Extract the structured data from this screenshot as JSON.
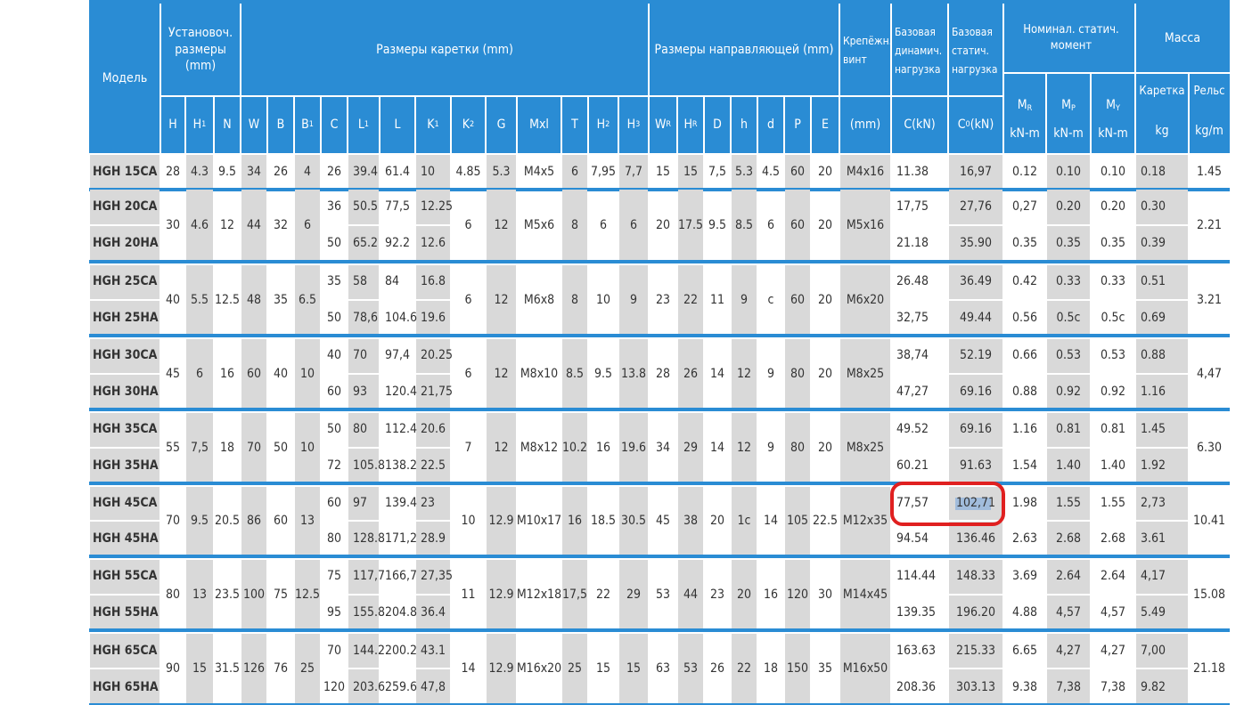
{
  "headers": {
    "model": "Модель",
    "mount": "Установоч. размеры (mm)",
    "carriage": "Размеры каретки (mm)",
    "rail": "Размеры направляющей (mm)",
    "bolt": "Крепёжн. винт",
    "dyn": "Базовая динамич. нагрузка",
    "stat": "Базовая статич. нагрузка",
    "moment": "Номинал. статич. момент",
    "mass": "Масса",
    "carriage_mass": "Каретка",
    "rail_mass": "Рельс"
  },
  "columns": [
    "H",
    "H1",
    "N",
    "W",
    "B",
    "B1",
    "C",
    "L1",
    "L",
    "K1",
    "K2",
    "G",
    "Mxl",
    "T",
    "H2",
    "H3",
    "WR",
    "HR",
    "D",
    "h",
    "d",
    "P",
    "E",
    "(mm)",
    "C(kN)",
    "C0 (kN)",
    "MR",
    "MP",
    "MY"
  ],
  "units": {
    "mr": "kN-m",
    "mp": "kN-m",
    "my": "kN-m",
    "carriage": "kg",
    "rail": "kg/m"
  },
  "groups": [
    {
      "rows": [
        "HGH 15CA"
      ],
      "H": "28",
      "H1": "4.3",
      "N": "9.5",
      "W": "34",
      "B": "26",
      "B1": "4",
      "K2": "4.85",
      "G": "5.3",
      "Mxl": "M4x5",
      "T": "6",
      "H2": "7,95",
      "H3": "7,7",
      "WR": "15",
      "HR": "15",
      "D": "7,5",
      "h": "5.3",
      "d": "4.5",
      "P": "60",
      "E": "20",
      "bolt": "M4x16",
      "rail": "1.45",
      "var": [
        {
          "C": "26",
          "L1": "39.4",
          "L": "61.4",
          "K1": "10",
          "C_dyn": "11.38",
          "C0": "16,97",
          "MR": "0.12",
          "MP": "0.10",
          "MY": "0.10",
          "m": "0.18"
        }
      ]
    },
    {
      "rows": [
        "HGH 20CA",
        "HGH 20HA"
      ],
      "H": "30",
      "H1": "4.6",
      "N": "12",
      "W": "44",
      "B": "32",
      "B1": "6",
      "K2": "6",
      "G": "12",
      "Mxl": "M5x6",
      "T": "8",
      "H2": "6",
      "H3": "6",
      "WR": "20",
      "HR": "17.5",
      "D": "9.5",
      "h": "8.5",
      "d": "6",
      "P": "60",
      "E": "20",
      "bolt": "M5x16",
      "rail": "2.21",
      "var": [
        {
          "C": "36",
          "L1": "50.5",
          "L": "77,5",
          "K1": "12.25",
          "C_dyn": "17,75",
          "C0": "27,76",
          "MR": "0,27",
          "MP": "0.20",
          "MY": "0.20",
          "m": "0.30"
        },
        {
          "C": "50",
          "L1": "65.2",
          "L": "92.2",
          "K1": "12.6",
          "C_dyn": "21.18",
          "C0": "35.90",
          "MR": "0.35",
          "MP": "0.35",
          "MY": "0.35",
          "m": "0.39"
        }
      ]
    },
    {
      "rows": [
        "HGH 25CA",
        "HGH 25HA"
      ],
      "H": "40",
      "H1": "5.5",
      "N": "12.5",
      "W": "48",
      "B": "35",
      "B1": "6.5",
      "K2": "6",
      "G": "12",
      "Mxl": "M6x8",
      "T": "8",
      "H2": "10",
      "H3": "9",
      "WR": "23",
      "HR": "22",
      "D": "11",
      "h": "9",
      "d": "c",
      "P": "60",
      "E": "20",
      "bolt": "M6x20",
      "rail": "3.21",
      "var": [
        {
          "C": "35",
          "L1": "58",
          "L": "84",
          "K1": "16.8",
          "C_dyn": "26.48",
          "C0": "36.49",
          "MR": "0.42",
          "MP": "0.33",
          "MY": "0.33",
          "m": "0.51"
        },
        {
          "C": "50",
          "L1": "78,6",
          "L": "104.6",
          "K1": "19.6",
          "C_dyn": "32,75",
          "C0": "49.44",
          "MR": "0.56",
          "MP": "0.5c",
          "MY": "0.5c",
          "m": "0.69"
        }
      ]
    },
    {
      "rows": [
        "HGH 30CA",
        "HGH 30HA"
      ],
      "H": "45",
      "H1": "6",
      "N": "16",
      "W": "60",
      "B": "40",
      "B1": "10",
      "K2": "6",
      "G": "12",
      "Mxl": "M8x10",
      "T": "8.5",
      "H2": "9.5",
      "H3": "13.8",
      "WR": "28",
      "HR": "26",
      "D": "14",
      "h": "12",
      "d": "9",
      "P": "80",
      "E": "20",
      "bolt": "M8x25",
      "rail": "4,47",
      "var": [
        {
          "C": "40",
          "L1": "70",
          "L": "97,4",
          "K1": "20.25",
          "C_dyn": "38,74",
          "C0": "52.19",
          "MR": "0.66",
          "MP": "0.53",
          "MY": "0.53",
          "m": "0.88"
        },
        {
          "C": "60",
          "L1": "93",
          "L": "120.4",
          "K1": "21,75",
          "C_dyn": "47,27",
          "C0": "69.16",
          "MR": "0.88",
          "MP": "0.92",
          "MY": "0.92",
          "m": "1.16"
        }
      ]
    },
    {
      "rows": [
        "HGH 35CA",
        "HGH 35HA"
      ],
      "H": "55",
      "H1": "7,5",
      "N": "18",
      "W": "70",
      "B": "50",
      "B1": "10",
      "K2": "7",
      "G": "12",
      "Mxl": "M8x12",
      "T": "10.2",
      "H2": "16",
      "H3": "19.6",
      "WR": "34",
      "HR": "29",
      "D": "14",
      "h": "12",
      "d": "9",
      "P": "80",
      "E": "20",
      "bolt": "M8x25",
      "rail": "6.30",
      "var": [
        {
          "C": "50",
          "L1": "80",
          "L": "112.4",
          "K1": "20.6",
          "C_dyn": "49.52",
          "C0": "69.16",
          "MR": "1.16",
          "MP": "0.81",
          "MY": "0.81",
          "m": "1.45"
        },
        {
          "C": "72",
          "L1": "105.8",
          "L": "138.2",
          "K1": "22.5",
          "C_dyn": "60.21",
          "C0": "91.63",
          "MR": "1.54",
          "MP": "1.40",
          "MY": "1.40",
          "m": "1.92"
        }
      ]
    },
    {
      "rows": [
        "HGH 45CA",
        "HGH 45HA"
      ],
      "H": "70",
      "H1": "9.5",
      "N": "20.5",
      "W": "86",
      "B": "60",
      "B1": "13",
      "K2": "10",
      "G": "12.9",
      "Mxl": "M10x17",
      "T": "16",
      "H2": "18.5",
      "H3": "30.5",
      "WR": "45",
      "HR": "38",
      "D": "20",
      "h": "1c",
      "d": "14",
      "P": "105",
      "E": "22.5",
      "bolt": "M12x35",
      "rail": "10.41",
      "var": [
        {
          "C": "60",
          "L1": "97",
          "L": "139.4",
          "K1": "23",
          "C_dyn": "77,57",
          "C0": "102,71",
          "MR": "1.98",
          "MP": "1.55",
          "MY": "1.55",
          "m": "2,73"
        },
        {
          "C": "80",
          "L1": "128.8",
          "L": "171,2",
          "K1": "28.9",
          "C_dyn": "94.54",
          "C0": "136.46",
          "MR": "2.63",
          "MP": "2.68",
          "MY": "2.68",
          "m": "3.61"
        }
      ]
    },
    {
      "rows": [
        "HGH 55CA",
        "HGH 55HA"
      ],
      "H": "80",
      "H1": "13",
      "N": "23.5",
      "W": "100",
      "B": "75",
      "B1": "12.5",
      "K2": "11",
      "G": "12.9",
      "Mxl": "M12x18",
      "T": "17,5",
      "H2": "22",
      "H3": "29",
      "WR": "53",
      "HR": "44",
      "D": "23",
      "h": "20",
      "d": "16",
      "P": "120",
      "E": "30",
      "bolt": "M14x45",
      "rail": "15.08",
      "var": [
        {
          "C": "75",
          "L1": "117,7",
          "L": "166,7",
          "K1": "27,35",
          "C_dyn": "114.44",
          "C0": "148.33",
          "MR": "3.69",
          "MP": "2.64",
          "MY": "2.64",
          "m": "4,17"
        },
        {
          "C": "95",
          "L1": "155.8",
          "L": "204.8",
          "K1": "36.4",
          "C_dyn": "139.35",
          "C0": "196.20",
          "MR": "4.88",
          "MP": "4,57",
          "MY": "4,57",
          "m": "5.49"
        }
      ]
    },
    {
      "rows": [
        "HGH 65CA",
        "HGH 65HA"
      ],
      "H": "90",
      "H1": "15",
      "N": "31.5",
      "W": "126",
      "B": "76",
      "B1": "25",
      "K2": "14",
      "G": "12.9",
      "Mxl": "M16x20",
      "T": "25",
      "H2": "15",
      "H3": "15",
      "WR": "63",
      "HR": "53",
      "D": "26",
      "h": "22",
      "d": "18",
      "P": "150",
      "E": "35",
      "bolt": "M16x50",
      "rail": "21.18",
      "var": [
        {
          "C": "70",
          "L1": "144.2",
          "L": "200.2",
          "K1": "43.1",
          "C_dyn": "163.63",
          "C0": "215.33",
          "MR": "6.65",
          "MP": "4,27",
          "MY": "4,27",
          "m": "7,00"
        },
        {
          "C": "120",
          "L1": "203.6",
          "L": "259.6",
          "K1": "47,8",
          "C_dyn": "208.36",
          "C0": "303.13",
          "MR": "9.38",
          "MP": "7,38",
          "MY": "7,38",
          "m": "9.82"
        }
      ]
    }
  ],
  "highlight": {
    "model": "HGH 45CA",
    "cells": [
      "77,57",
      "102,71"
    ]
  },
  "colors": {
    "header": "#2a8cd4",
    "shade": "#d9d9d9",
    "ring": "#e02020"
  }
}
